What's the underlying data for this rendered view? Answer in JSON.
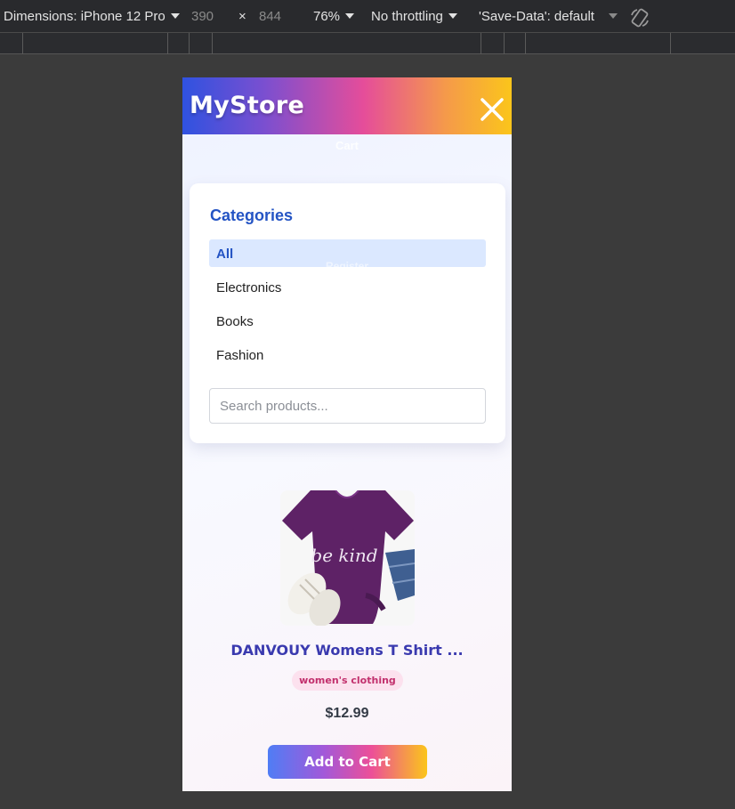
{
  "devtools": {
    "dimensions_label": "Dimensions: iPhone 12 Pro",
    "width_value": "390",
    "times_symbol": "×",
    "height_value": "844",
    "zoom": "76%",
    "throttling": "No throttling",
    "save_data": "'Save-Data': default"
  },
  "header": {
    "logo": "MyStore",
    "menu_ghost_items": [
      "Cart",
      "Register"
    ]
  },
  "categories": {
    "title": "Categories",
    "items": [
      "All",
      "Electronics",
      "Books",
      "Fashion"
    ],
    "active": "All"
  },
  "search": {
    "placeholder": "Search products..."
  },
  "product": {
    "name": "DANVOUY Womens T Shirt ...",
    "category_badge": "women's clothing",
    "price": "$12.99",
    "add_to_cart_label": "Add to Cart",
    "image_text": "be kind"
  },
  "colors": {
    "header_gradient": [
      "#2f52e0",
      "#e54d9a",
      "#fbc51b"
    ],
    "accent_blue": "#2454c4",
    "product_title": "#3a3aaf",
    "badge_text": "#c2306d"
  }
}
